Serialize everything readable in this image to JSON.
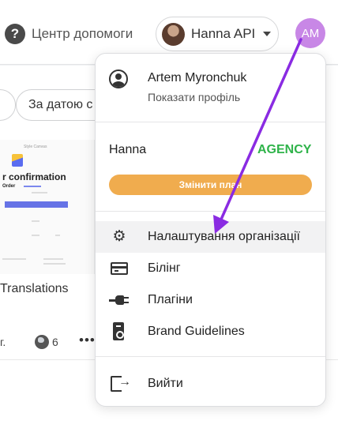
{
  "topbar": {
    "help_label": "Центр допомоги",
    "account_label": "Hanna API",
    "user_initials": "AM"
  },
  "background": {
    "sort_label": "За датою с",
    "card_title": "Translations",
    "card_meta_prefix": "г.",
    "card_count": "6",
    "thumbnail": {
      "brand": "Style Canvas",
      "title": "r confirmation",
      "order_label": "Order"
    }
  },
  "menu": {
    "profile": {
      "name": "Artem Myronchuk",
      "link": "Показати профіль"
    },
    "org": {
      "name": "Hanna",
      "plan": "AGENCY",
      "change_plan_label": "Змінити план"
    },
    "items": [
      {
        "label": "Налаштування організації",
        "icon": "gear-icon"
      },
      {
        "label": "Білінг",
        "icon": "credit-card-icon"
      },
      {
        "label": "Плагіни",
        "icon": "plug-icon"
      },
      {
        "label": "Brand Guidelines",
        "icon": "guideline-icon"
      }
    ],
    "logout_label": "Вийти"
  },
  "colors": {
    "plan_badge": "#2fb34a",
    "change_plan_button": "#f0ac4e",
    "avatar": "#c887e6",
    "annotation_arrow": "#8a2be2"
  }
}
